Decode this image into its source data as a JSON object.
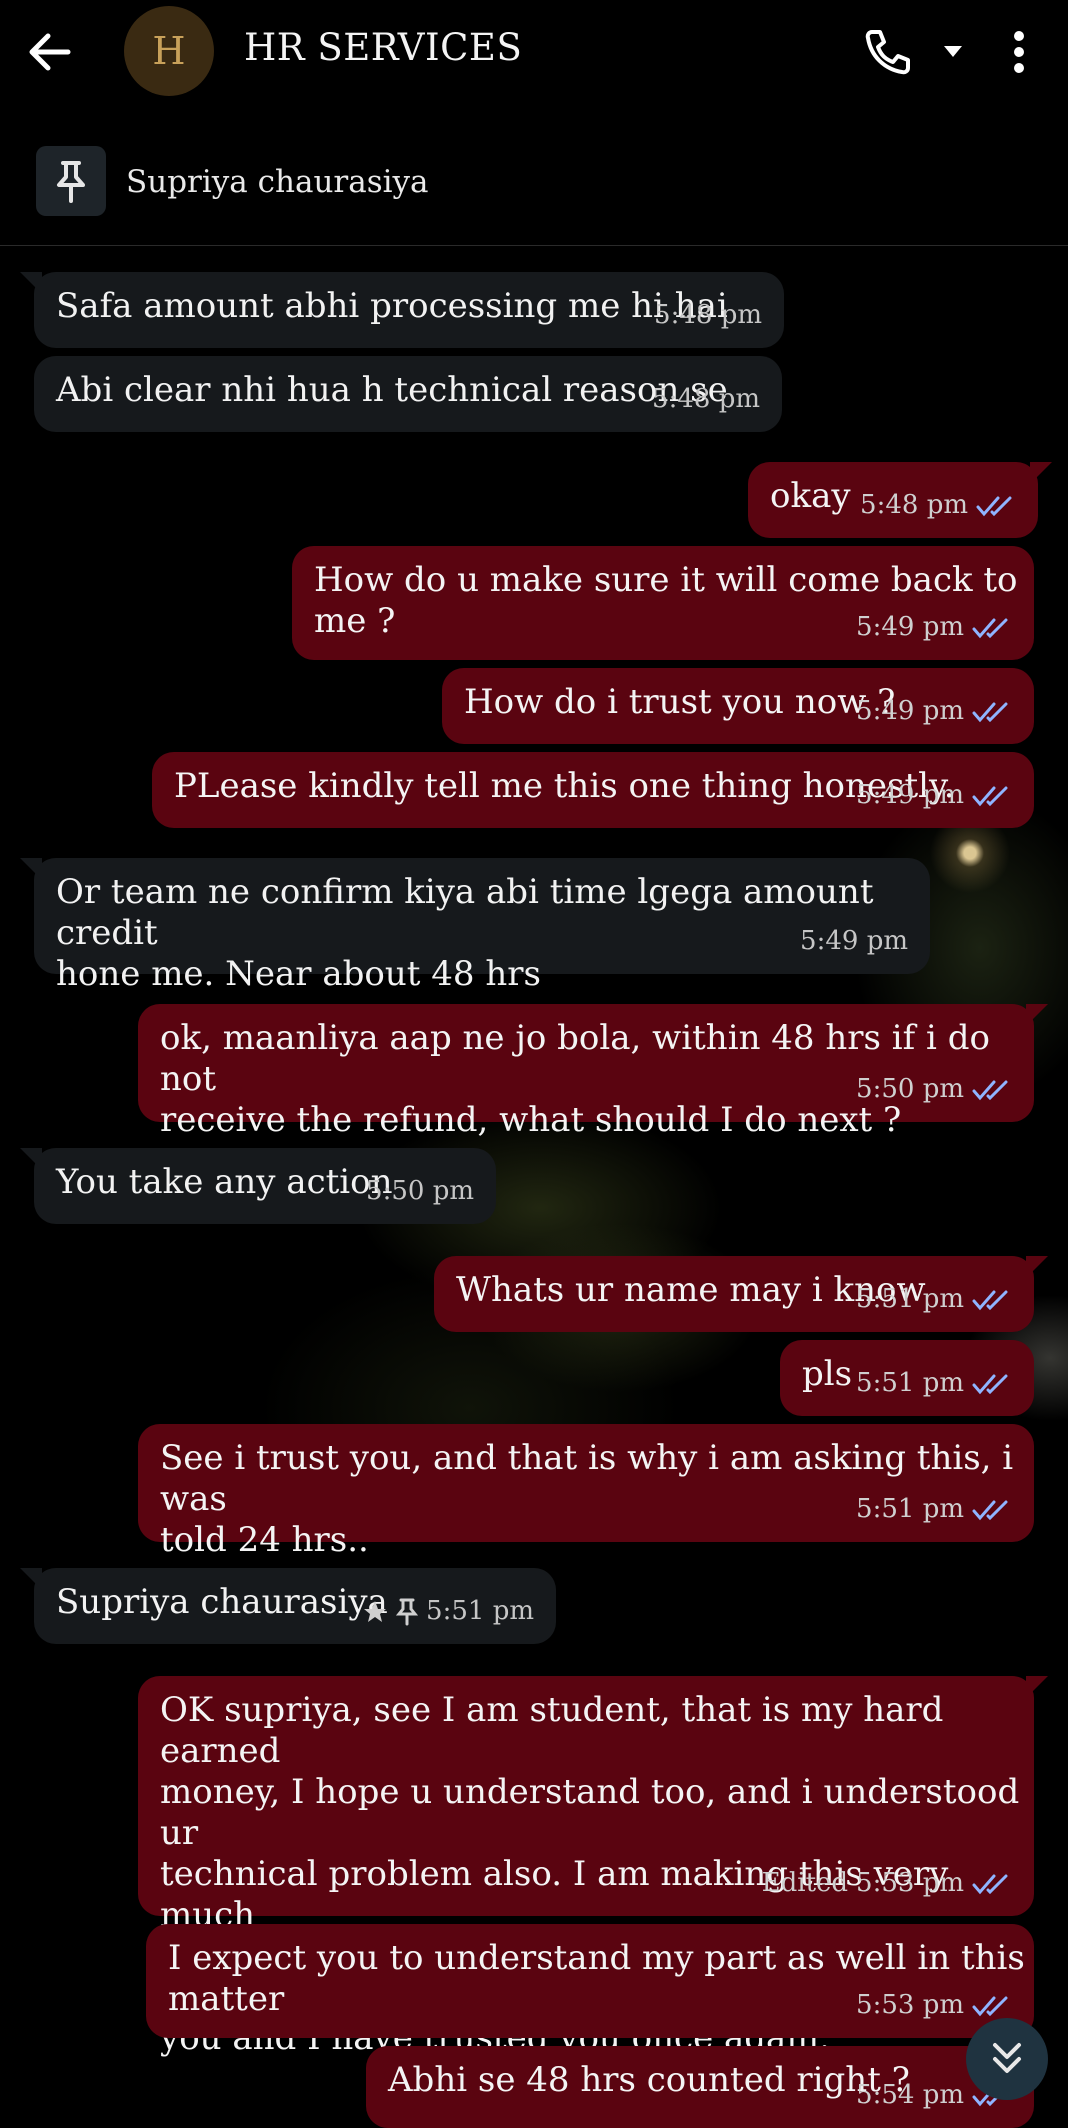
{
  "header": {
    "avatar_letter": "H",
    "title": "HR SERVICES"
  },
  "pinned": {
    "name": "Supriya chaurasiya"
  },
  "messages": [
    {
      "dir": "in",
      "text": "Safa amount abhi processing me hi hai",
      "time": "5:48 pm"
    },
    {
      "dir": "in",
      "text": "Abi clear nhi hua h technical reason se",
      "time": "5:48 pm"
    },
    {
      "dir": "out",
      "text": "okay",
      "time": "5:48 pm"
    },
    {
      "dir": "out",
      "text": "How do u make sure it will come back to me ?",
      "time": "5:49 pm"
    },
    {
      "dir": "out",
      "text": "How do i trust you now ?",
      "time": "5:49 pm"
    },
    {
      "dir": "out",
      "text": "PLease kindly tell me this one thing honestly.",
      "time": "5:49 pm"
    },
    {
      "dir": "in",
      "text": "Or team ne confirm kiya abi time lgega amount credit\nhone me. Near about 48 hrs",
      "time": "5:49 pm"
    },
    {
      "dir": "out",
      "text": "ok, maanliya aap ne jo bola, within 48 hrs if i do not\nreceive the refund, what should I do next ?",
      "time": "5:50 pm"
    },
    {
      "dir": "in",
      "text": "You take any action",
      "time": "5:50 pm"
    },
    {
      "dir": "out",
      "text": "Whats ur name may i know",
      "time": "5:51 pm"
    },
    {
      "dir": "out",
      "text": "pls",
      "time": "5:51 pm"
    },
    {
      "dir": "out",
      "text": "See i trust you, and that is why i am asking this, i was\ntold 24 hrs..",
      "time": "5:51 pm"
    },
    {
      "dir": "in",
      "text": "Supriya chaurasiya",
      "time": "5:51 pm"
    },
    {
      "dir": "out",
      "text": "OK supriya, see I am student, that is my hard earned\nmoney, I hope u understand too, and i understood ur\ntechnical problem also. I am making this very much\nclear, within 48 hrs I need the refund anyhow. I respect\nyou and I have trusted you once again.",
      "time": "5:53 pm",
      "edited": "Edited"
    },
    {
      "dir": "out",
      "text": "I expect you to understand my part as well in this matter",
      "time": "5:53 pm"
    },
    {
      "dir": "out",
      "text": "Abhi se 48 hrs counted right ?",
      "time": "5:54 pm"
    }
  ],
  "colors": {
    "incoming_bubble": "#16191c",
    "outgoing_bubble": "#5a0410",
    "read_ticks": "#8fb4ff"
  }
}
